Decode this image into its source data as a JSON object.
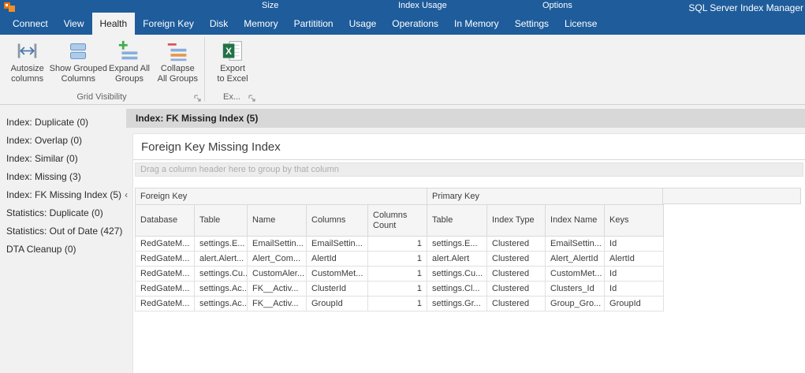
{
  "titlebar": {
    "app_title": "SQL Server Index Manager",
    "contextual_groups": [
      {
        "label": "Size"
      },
      {
        "label": "Index Usage"
      },
      {
        "label": "Options"
      }
    ]
  },
  "tabs": [
    {
      "label": "Connect"
    },
    {
      "label": "View"
    },
    {
      "label": "Health"
    },
    {
      "label": "Foreign Key"
    },
    {
      "label": "Disk"
    },
    {
      "label": "Memory"
    },
    {
      "label": "Partitition"
    },
    {
      "label": "Usage"
    },
    {
      "label": "Operations"
    },
    {
      "label": "In Memory"
    },
    {
      "label": "Settings"
    },
    {
      "label": "License"
    }
  ],
  "ribbon": {
    "buttons": [
      {
        "line1": "Autosize",
        "line2": "columns"
      },
      {
        "line1": "Show Grouped",
        "line2": "Columns"
      },
      {
        "line1": "Expand All",
        "line2": "Groups"
      },
      {
        "line1": "Collapse",
        "line2": "All Groups"
      },
      {
        "line1": "Export",
        "line2": "to Excel"
      }
    ],
    "group_captions": [
      {
        "label": "Grid Visibility"
      },
      {
        "label": "Ex..."
      }
    ]
  },
  "sidebar": {
    "items": [
      {
        "label": "Index: Duplicate (0)"
      },
      {
        "label": "Index: Overlap (0)"
      },
      {
        "label": "Index: Similar (0)"
      },
      {
        "label": "Index: Missing (3)"
      },
      {
        "label": "Index: FK Missing Index (5)"
      },
      {
        "label": "Statistics: Duplicate (0)"
      },
      {
        "label": "Statistics: Out of Date (427)"
      },
      {
        "label": "DTA Cleanup (0)"
      }
    ],
    "selected_marker": "‹"
  },
  "main": {
    "header": "Index: FK Missing Index (5)",
    "panel_title": "Foreign Key Missing Index",
    "group_hint": "Drag a column header here to group by that column",
    "grid": {
      "bands": [
        {
          "label": "Foreign Key"
        },
        {
          "label": "Primary Key"
        }
      ],
      "columns": [
        {
          "label": "Database"
        },
        {
          "label": "Table"
        },
        {
          "label": "Name"
        },
        {
          "label": "Columns"
        },
        {
          "label": "Columns Count"
        },
        {
          "label": "Table"
        },
        {
          "label": "Index Type"
        },
        {
          "label": "Index Name"
        },
        {
          "label": "Keys"
        }
      ],
      "rows": [
        [
          "RedGateM...",
          "settings.E...",
          "EmailSettin...",
          "EmailSettin...",
          "1",
          "settings.E...",
          "Clustered",
          "EmailSettin...",
          "Id"
        ],
        [
          "RedGateM...",
          "alert.Alert...",
          "Alert_Com...",
          "AlertId",
          "1",
          "alert.Alert",
          "Clustered",
          "Alert_AlertId",
          "AlertId"
        ],
        [
          "RedGateM...",
          "settings.Cu...",
          "CustomAler...",
          "CustomMet...",
          "1",
          "settings.Cu...",
          "Clustered",
          "CustomMet...",
          "Id"
        ],
        [
          "RedGateM...",
          "settings.Ac...",
          "FK__Activ...",
          "ClusterId",
          "1",
          "settings.Cl...",
          "Clustered",
          "Clusters_Id",
          "Id"
        ],
        [
          "RedGateM...",
          "settings.Ac...",
          "FK__Activ...",
          "GroupId",
          "1",
          "settings.Gr...",
          "Clustered",
          "Group_Gro...",
          "GroupId"
        ]
      ]
    }
  },
  "colors": {
    "titlebar_blue": "#1e5c9b",
    "ribbon_bg": "#f2f2f2",
    "header_strip_gray": "#d8d8d8",
    "excel_green": "#217346",
    "expand_plus_green": "#3fae49",
    "collapse_minus_red": "#d9534f",
    "app_icon_orange": "#e8710a"
  }
}
